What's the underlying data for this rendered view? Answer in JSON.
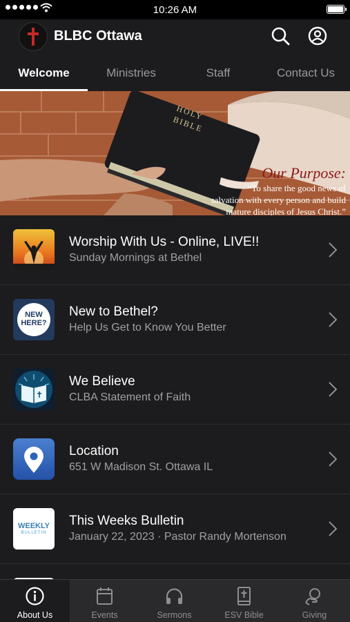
{
  "status_bar": {
    "time": "10:26 AM"
  },
  "app": {
    "title": "BLBC Ottawa"
  },
  "top_tabs": [
    {
      "label": "Welcome",
      "active": true
    },
    {
      "label": "Ministries",
      "active": false
    },
    {
      "label": "Staff",
      "active": false
    },
    {
      "label": "Contact Us",
      "active": false
    }
  ],
  "hero": {
    "bible_text_1": "HOLY",
    "bible_text_2": "BIBLE",
    "heading": "Our Purpose:",
    "quote_1": "“To share the good news of",
    "quote_2": "salvation with every person and build",
    "quote_3": "mature disciples of Jesus Christ.”"
  },
  "items": [
    {
      "title": "Worship With Us - Online, LIVE!!",
      "subtitle": "Sunday Mornings at Bethel",
      "icon": "worship-icon"
    },
    {
      "title": "New to Bethel?",
      "subtitle": "Help Us Get to Know You Better",
      "icon": "new-here-icon",
      "badge_1": "NEW",
      "badge_2": "HERE?"
    },
    {
      "title": "We Believe",
      "subtitle": "CLBA Statement of Faith",
      "icon": "bible-icon"
    },
    {
      "title": "Location",
      "subtitle": "651 W Madison St. Ottawa IL",
      "icon": "map-pin-icon"
    },
    {
      "title": "This Weeks Bulletin",
      "subtitle": "January 22, 2023 · Pastor Randy Mortenson",
      "icon": "bulletin-icon",
      "badge_1": "WEEKLY",
      "badge_2": "BULLETIN"
    }
  ],
  "bottom_tabs": [
    {
      "label": "About Us",
      "icon": "info-icon",
      "active": true
    },
    {
      "label": "Events",
      "icon": "calendar-icon",
      "active": false
    },
    {
      "label": "Sermons",
      "icon": "headphones-icon",
      "active": false
    },
    {
      "label": "ESV Bible",
      "icon": "bible-book-icon",
      "active": false
    },
    {
      "label": "Giving",
      "icon": "giving-icon",
      "active": false
    }
  ],
  "colors": {
    "background": "#1c1c1e",
    "accent": "#ffffff",
    "muted": "#a0a0a5",
    "logo_cross": "#c62828"
  }
}
